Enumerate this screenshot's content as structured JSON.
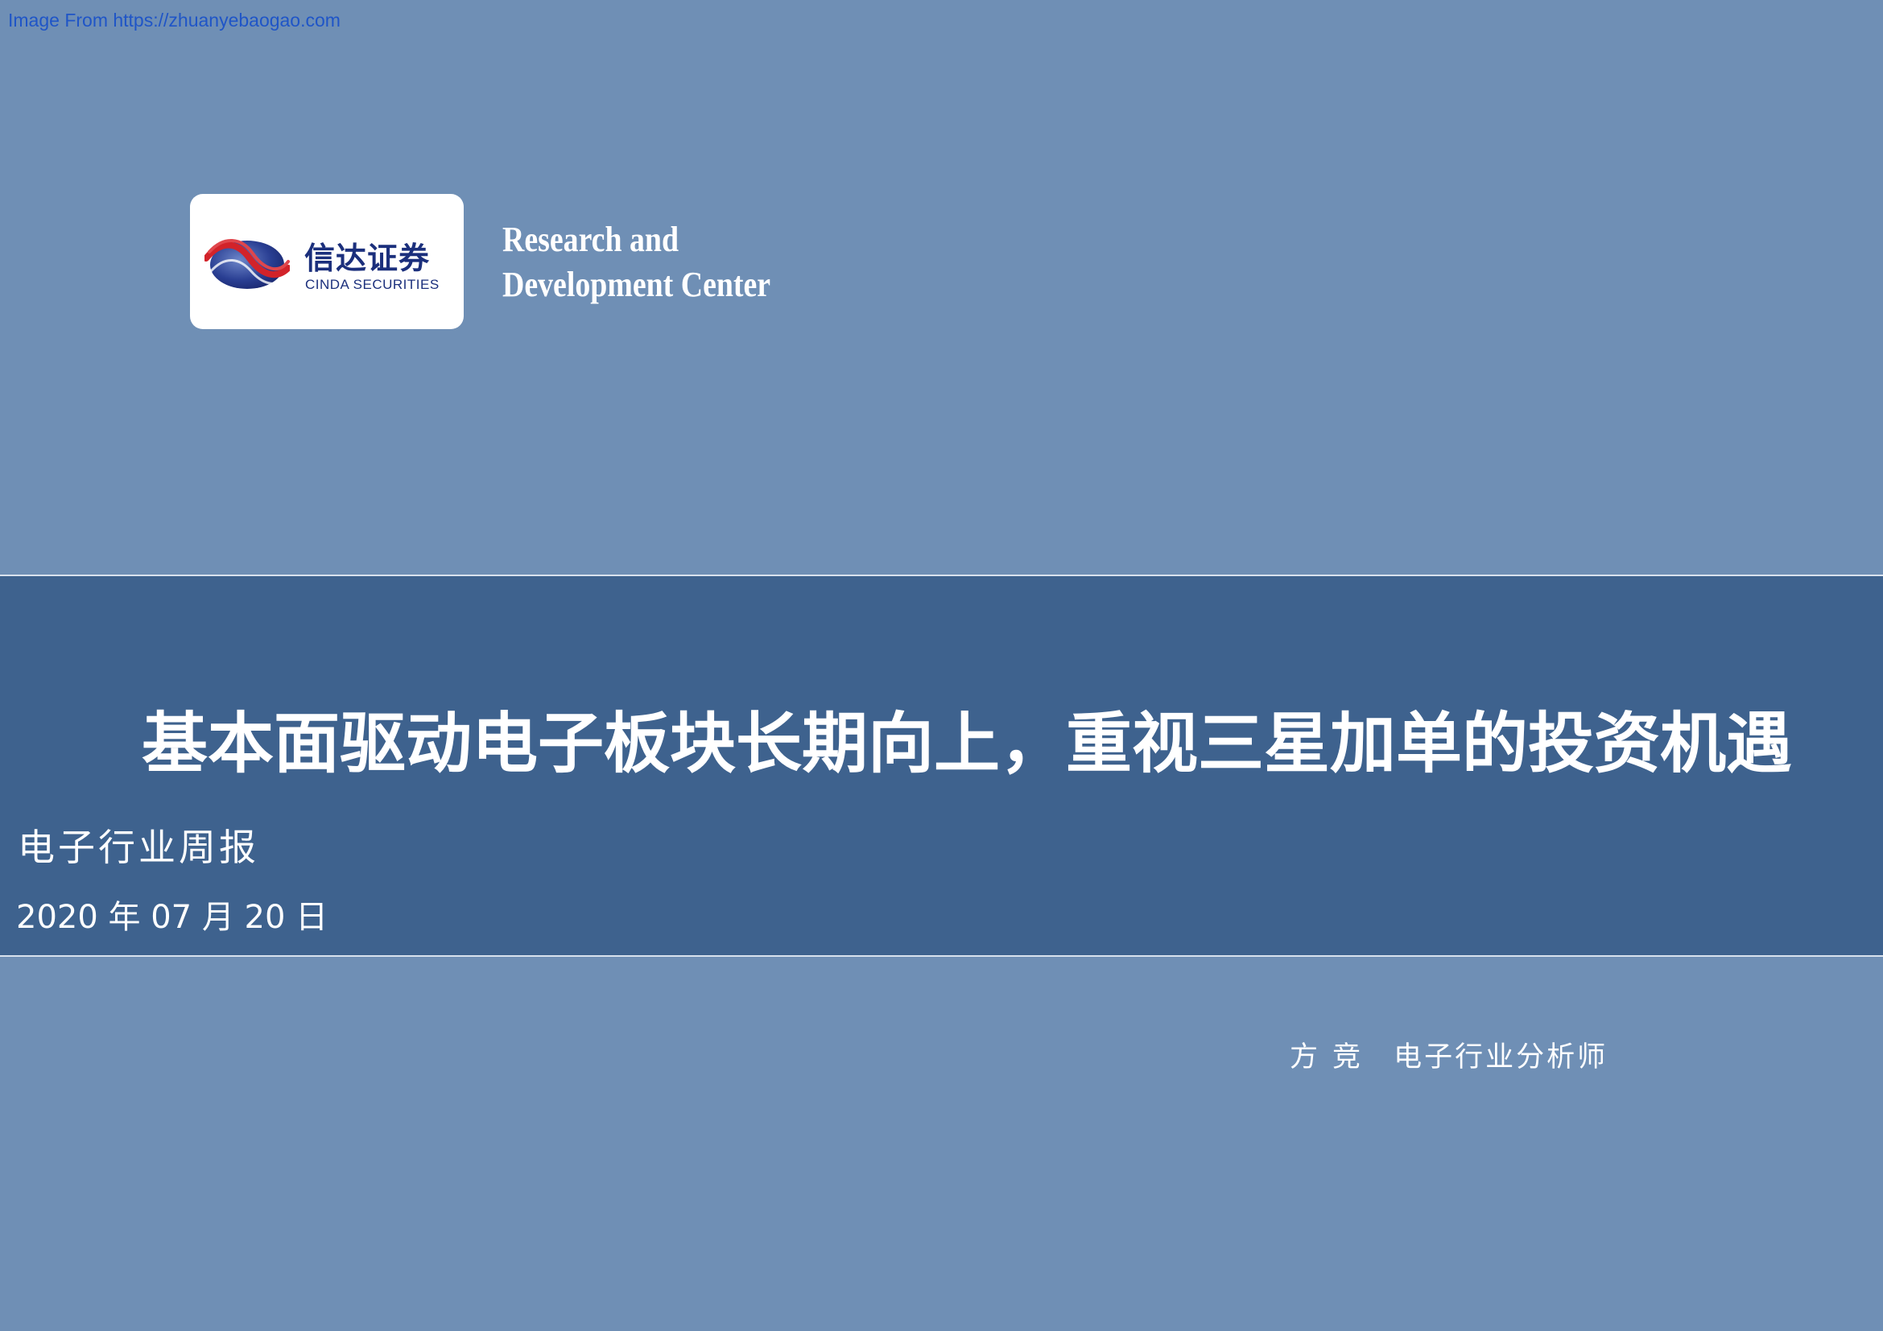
{
  "source_link": "Image From https://zhuanyebaogao.com",
  "logo": {
    "name_cn": "信达证券",
    "name_en": "CINDA SECURITIES",
    "brand_colors": {
      "red": "#d2232a",
      "navy": "#1b2f7c"
    }
  },
  "center": {
    "line1": "Research and",
    "line2": "Development Center"
  },
  "report": {
    "title": "基本面驱动电子板块长期向上，重视三星加单的投资机遇",
    "type": "电子行业周报",
    "date": "2020 年 07 月 20 日"
  },
  "analyst": {
    "name": "方竞",
    "title": "电子行业分析师"
  },
  "colors": {
    "background": "#6f8fb5",
    "band": "#3e628e",
    "text": "#ffffff",
    "link": "#1f55c7"
  }
}
